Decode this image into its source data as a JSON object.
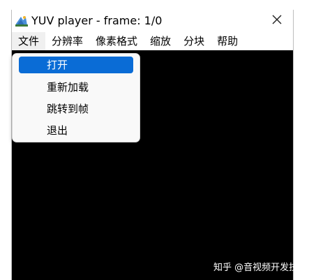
{
  "window": {
    "title": "YUV player - frame: 1/0",
    "close_glyph": "✕"
  },
  "menubar": {
    "items": [
      {
        "label": "文件"
      },
      {
        "label": "分辨率"
      },
      {
        "label": "像素格式"
      },
      {
        "label": "缩放"
      },
      {
        "label": "分块"
      },
      {
        "label": "帮助"
      }
    ]
  },
  "file_menu": {
    "items": [
      {
        "label": "打开",
        "selected": true
      },
      {
        "label": "重新加载"
      },
      {
        "label": "跳转到帧"
      },
      {
        "label": "退出"
      }
    ]
  },
  "watermark": {
    "text": "知乎 @音视频开发技术"
  },
  "colors": {
    "highlight": "#0a6cd6",
    "canvas": "#000000"
  },
  "icons": {
    "app": "yuv-player-app-icon",
    "close": "close-icon"
  }
}
